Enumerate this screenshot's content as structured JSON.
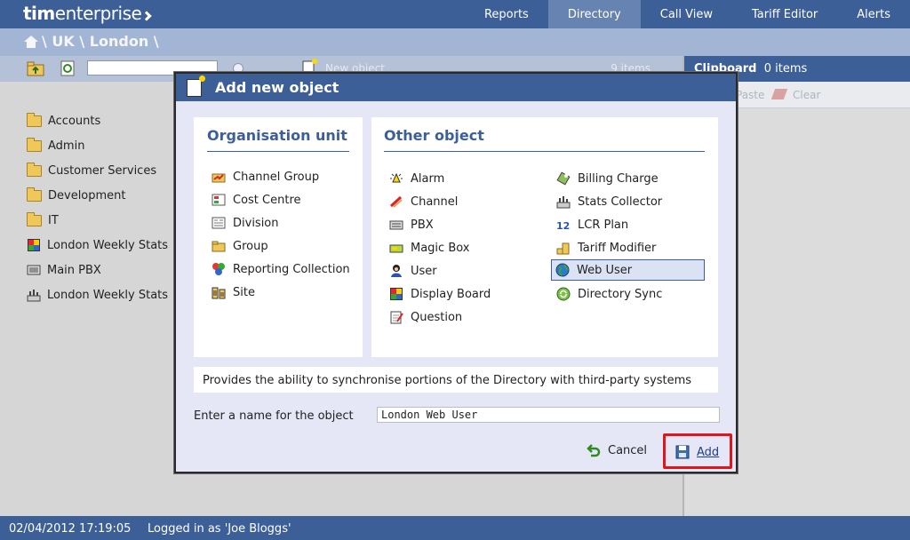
{
  "app": {
    "logo_bold": "tim",
    "logo_light": "enterprise"
  },
  "nav": {
    "items": [
      {
        "label": "Reports",
        "active": false
      },
      {
        "label": "Directory",
        "active": true
      },
      {
        "label": "Call View",
        "active": false
      },
      {
        "label": "Tariff Editor",
        "active": false
      },
      {
        "label": "Alerts",
        "active": false
      }
    ]
  },
  "breadcrumb": {
    "path": "\\ UK \\ London \\"
  },
  "toolbar": {
    "new_object_label": "New object",
    "item_count": "9 items",
    "search_value": ""
  },
  "clipboard": {
    "title": "Clipboard",
    "count": "0 items",
    "paste_label": "Paste",
    "clear_label": "Clear"
  },
  "tree": {
    "items": [
      {
        "label": "Accounts",
        "icon": "folder-icon"
      },
      {
        "label": "Admin",
        "icon": "folder-icon"
      },
      {
        "label": "Customer Services",
        "icon": "folder-icon"
      },
      {
        "label": "Development",
        "icon": "folder-icon"
      },
      {
        "label": "IT",
        "icon": "folder-icon"
      },
      {
        "label": "London Weekly Stats",
        "icon": "display-board-icon"
      },
      {
        "label": "Main PBX",
        "icon": "pbx-icon"
      },
      {
        "label": "London Weekly Stats",
        "icon": "stats-collector-icon"
      }
    ]
  },
  "modal": {
    "title": "Add new object",
    "org_title": "Organisation unit",
    "org_items": [
      "Channel Group",
      "Cost Centre",
      "Division",
      "Group",
      "Reporting Collection",
      "Site"
    ],
    "other_title": "Other object",
    "other_left": [
      "Alarm",
      "Channel",
      "PBX",
      "Magic Box",
      "User",
      "Display Board",
      "Question"
    ],
    "other_right": [
      "Billing Charge",
      "Stats Collector",
      "LCR Plan",
      "Tariff Modifier",
      "Web User",
      "Directory Sync"
    ],
    "selected": "Web User",
    "description": "Provides the ability to synchronise portions of the Directory with third-party systems",
    "name_label": "Enter a name for the object",
    "name_value": "London Web User",
    "cancel_label": "Cancel",
    "add_label": "Add"
  },
  "status": {
    "datetime": "02/04/2012 17:19:05",
    "login": "Logged in as 'Joe Bloggs'"
  },
  "colors": {
    "brand": "#3d5f98",
    "highlight": "#e0161b",
    "folder": "#f0c85a"
  }
}
